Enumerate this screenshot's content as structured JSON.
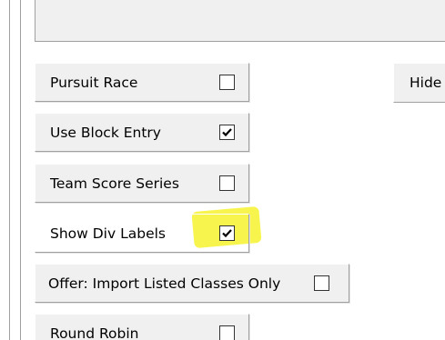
{
  "options": [
    {
      "label": "Pursuit Race",
      "checked": false
    },
    {
      "label": "Use Block Entry",
      "checked": true
    },
    {
      "label": "Team Score Series",
      "checked": false
    },
    {
      "label": "Show Div Labels",
      "checked": true
    },
    {
      "label": "Offer: Import Listed Classes Only",
      "checked": false
    },
    {
      "label": "Round Robin",
      "checked": false
    }
  ],
  "hide_button_label": "Hide",
  "colors": {
    "panel_background": "#f0f0f0",
    "highlight": "#f6f32e",
    "checkbox_border": "#333333"
  }
}
